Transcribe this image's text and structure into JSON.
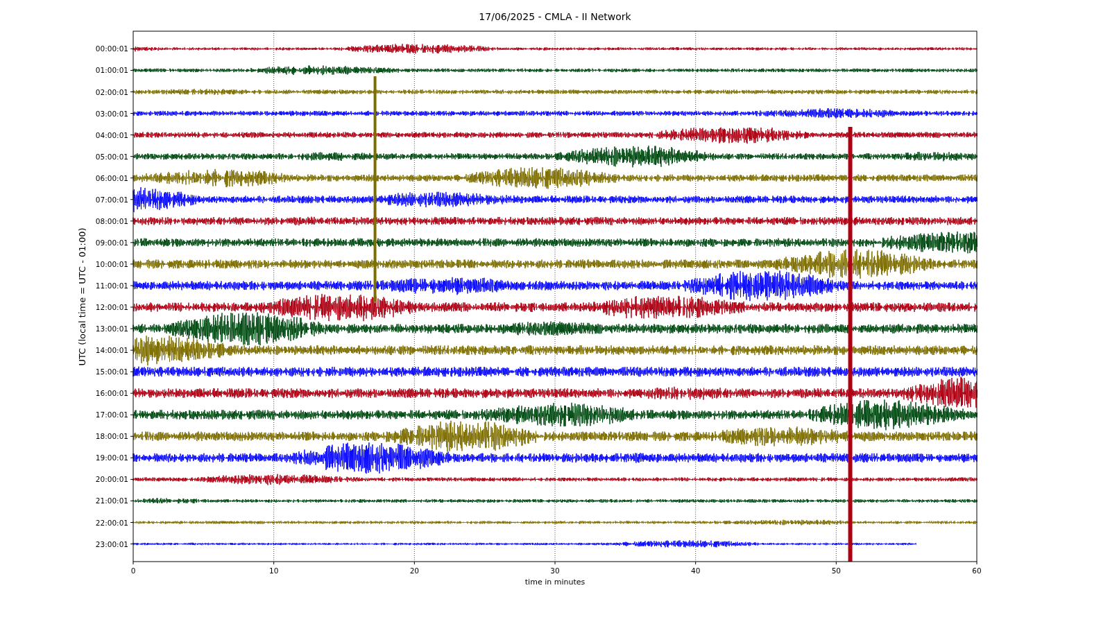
{
  "title": "17/06/2025 - CMLA - II Network",
  "xlabel": "time in minutes",
  "ylabel": "UTC (local time = UTC - 01:00)",
  "xticks": [
    "0",
    "10",
    "20",
    "30",
    "40",
    "50",
    "60"
  ],
  "rows": [
    {
      "label": "00:00:01",
      "color": "#b00013"
    },
    {
      "label": "01:00:01",
      "color": "#004b12"
    },
    {
      "label": "02:00:01",
      "color": "#7e6e00"
    },
    {
      "label": "03:00:01",
      "color": "#0a0aff"
    },
    {
      "label": "04:00:01",
      "color": "#b00013"
    },
    {
      "label": "05:00:01",
      "color": "#004b12"
    },
    {
      "label": "06:00:01",
      "color": "#7e6e00"
    },
    {
      "label": "07:00:01",
      "color": "#0a0aff"
    },
    {
      "label": "08:00:01",
      "color": "#b00013"
    },
    {
      "label": "09:00:01",
      "color": "#004b12"
    },
    {
      "label": "10:00:01",
      "color": "#7e6e00"
    },
    {
      "label": "11:00:01",
      "color": "#0a0aff"
    },
    {
      "label": "12:00:01",
      "color": "#b00013"
    },
    {
      "label": "13:00:01",
      "color": "#004b12"
    },
    {
      "label": "14:00:01",
      "color": "#7e6e00"
    },
    {
      "label": "15:00:01",
      "color": "#0a0aff"
    },
    {
      "label": "16:00:01",
      "color": "#b00013"
    },
    {
      "label": "17:00:01",
      "color": "#004b12"
    },
    {
      "label": "18:00:01",
      "color": "#7e6e00"
    },
    {
      "label": "19:00:01",
      "color": "#0a0aff"
    },
    {
      "label": "20:00:01",
      "color": "#b00013"
    },
    {
      "label": "21:00:01",
      "color": "#004b12"
    },
    {
      "label": "22:00:01",
      "color": "#7e6e00"
    },
    {
      "label": "23:00:01",
      "color": "#0a0aff"
    }
  ]
}
